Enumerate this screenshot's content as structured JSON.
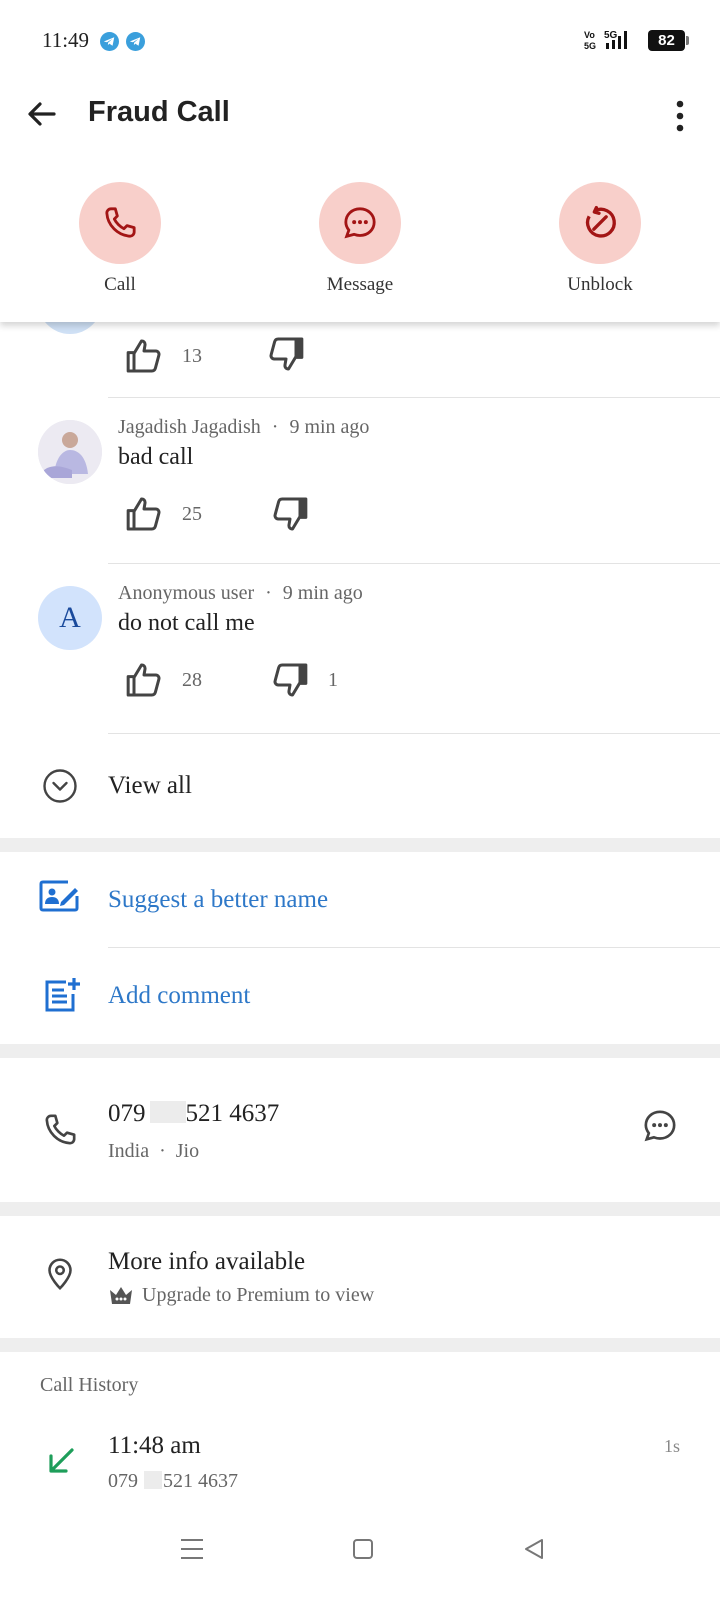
{
  "status_bar": {
    "time": "11:49",
    "battery": "82",
    "network": "5G",
    "volte": "Vo 5G",
    "icons": [
      "telegram-icon",
      "telegram-icon",
      "signal-icon",
      "battery-icon"
    ]
  },
  "header": {
    "title": "Fraud Call",
    "actions": [
      {
        "label": "Call",
        "icon": "phone-icon"
      },
      {
        "label": "Message",
        "icon": "message-icon"
      },
      {
        "label": "Unblock",
        "icon": "unblock-icon"
      }
    ]
  },
  "comments": [
    {
      "author": "",
      "time": "",
      "text": "",
      "likes": "13",
      "dislikes": ""
    },
    {
      "author": "Jagadish Jagadish",
      "time": "9 min ago",
      "text": "bad call",
      "likes": "25",
      "dislikes": ""
    },
    {
      "author": "Anonymous user",
      "time": "9 min ago",
      "text": "do not call me",
      "likes": "28",
      "dislikes": "1",
      "avatar_letter": "A"
    }
  ],
  "separator": "·",
  "view_all": "View all",
  "suggest_name": "Suggest a better name",
  "add_comment": "Add comment",
  "contact": {
    "number": "079 ⁠521 4637",
    "number_prefix": "079",
    "number_suffix": "521 4637",
    "country": "India",
    "carrier": "Jio"
  },
  "more_info": {
    "title": "More info available",
    "upgrade": "Upgrade to Premium to view"
  },
  "call_history": {
    "heading": "Call History",
    "entries": [
      {
        "time": "11:48 am",
        "number_prefix": "079",
        "number_suffix": "521 4637",
        "duration": "1s",
        "type": "incoming"
      }
    ]
  },
  "colors": {
    "accent_red": "#a31515",
    "action_bg": "#f8cfca",
    "link_blue": "#2e78c8",
    "incoming_green": "#1e9e5a"
  }
}
